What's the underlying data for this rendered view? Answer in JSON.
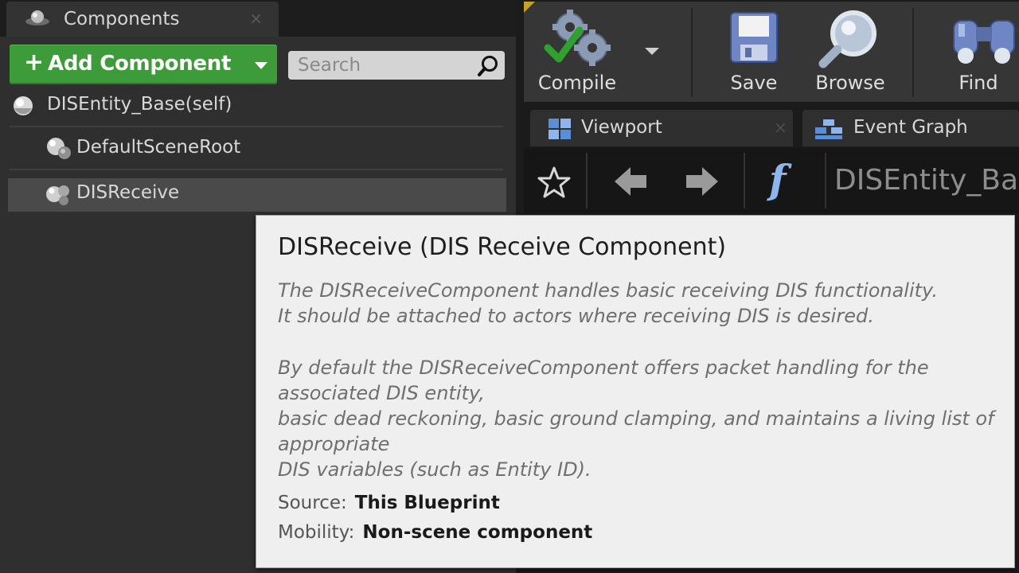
{
  "components_panel": {
    "tab_label": "Components",
    "tab_close": "×",
    "add_button": {
      "plus": "+",
      "label": "Add Component"
    },
    "search": {
      "placeholder": "Search",
      "value": ""
    },
    "tree": [
      {
        "label": "DISEntity_Base(self)",
        "icon": "sphere-icon"
      },
      {
        "label": "DefaultSceneRoot",
        "icon": "scene-root-icon"
      },
      {
        "label": "DISReceive",
        "icon": "component-icon",
        "selected": true
      }
    ]
  },
  "toolbar": {
    "compile": "Compile",
    "save": "Save",
    "browse": "Browse",
    "find": "Find"
  },
  "doc_tabs": {
    "viewport": "Viewport",
    "viewport_close": "×",
    "event_graph": "Event Graph"
  },
  "nav": {
    "function_glyph": "f",
    "title": "DISEntity_Ba"
  },
  "tooltip": {
    "title": "DISReceive (DIS Receive Component)",
    "description_lines": [
      "The DISReceiveComponent handles basic receiving DIS functionality.",
      "It should be attached to actors where receiving DIS is desired.",
      "By default the DISReceiveComponent offers packet handling for the associated DIS entity,",
      "basic dead reckoning, basic ground clamping, and maintains a living list of appropriate",
      "DIS variables (such as Entity ID)."
    ],
    "source_label": "Source:",
    "source_value": "This Blueprint",
    "mobility_label": "Mobility:",
    "mobility_value": "Non-scene component"
  },
  "colors": {
    "add_button_green": "#3e9b3a",
    "compile_check_green": "#2fa12f",
    "tooltip_bg": "#efefef"
  }
}
